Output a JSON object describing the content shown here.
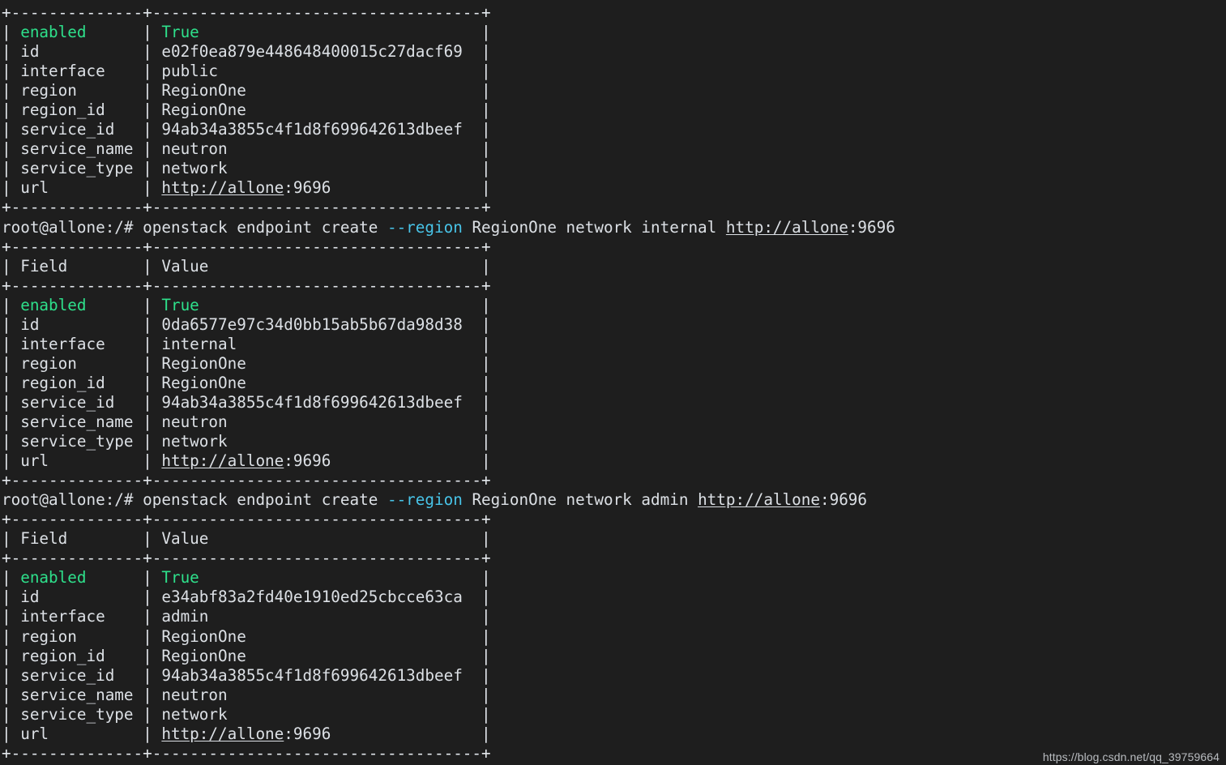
{
  "terminal": {
    "background_color": "#1e1e1e",
    "foreground_color": "#dce0e5",
    "accent_green": "#2ee08b",
    "accent_cyan": "#48c4e8",
    "prompt": "root@allone:/#",
    "rule_top": "+--------------+-----------------------------------+",
    "rule_mid": "+--------------+-----------------------------------+",
    "rule_bottom": "+--------------+-----------------------------------+"
  },
  "watermark": "https://blog.csdn.net/qq_39759664",
  "headers": {
    "field": "| Field        | Value                             |",
    "field_label": "Field",
    "value_label": "Value"
  },
  "blocks": [
    {
      "id": "block-public",
      "has_command": false,
      "command": {
        "prompt": "",
        "pre": "",
        "flag": "",
        "post": "",
        "url": "",
        "port": ""
      },
      "has_header": false,
      "rows": [
        {
          "field": "enabled",
          "value": "True",
          "field_color": "green",
          "value_color": "green",
          "link": false
        },
        {
          "field": "id",
          "value": "e02f0ea879e448648400015c27dacf69",
          "field_color": "default",
          "value_color": "default",
          "link": false
        },
        {
          "field": "interface",
          "value": "public",
          "field_color": "default",
          "value_color": "default",
          "link": false
        },
        {
          "field": "region",
          "value": "RegionOne",
          "field_color": "default",
          "value_color": "default",
          "link": false
        },
        {
          "field": "region_id",
          "value": "RegionOne",
          "field_color": "default",
          "value_color": "default",
          "link": false
        },
        {
          "field": "service_id",
          "value": "94ab34a3855c4f1d8f699642613dbeef",
          "field_color": "default",
          "value_color": "default",
          "link": false
        },
        {
          "field": "service_name",
          "value": "neutron",
          "field_color": "default",
          "value_color": "default",
          "link": false
        },
        {
          "field": "service_type",
          "value": "network",
          "field_color": "default",
          "value_color": "default",
          "link": false
        },
        {
          "field": "url",
          "value": "http://allone:9696",
          "field_color": "default",
          "value_color": "default",
          "link": true,
          "link_text": "http://allone",
          "link_tail": ":9696"
        }
      ]
    },
    {
      "id": "block-internal",
      "has_command": true,
      "command": {
        "prompt": "root@allone:/#",
        "pre": " openstack endpoint create ",
        "flag": "--region",
        "post": " RegionOne network internal ",
        "url": "http://allone",
        "port": ":9696"
      },
      "has_header": true,
      "rows": [
        {
          "field": "enabled",
          "value": "True",
          "field_color": "green",
          "value_color": "green",
          "link": false
        },
        {
          "field": "id",
          "value": "0da6577e97c34d0bb15ab5b67da98d38",
          "field_color": "default",
          "value_color": "default",
          "link": false
        },
        {
          "field": "interface",
          "value": "internal",
          "field_color": "default",
          "value_color": "default",
          "link": false
        },
        {
          "field": "region",
          "value": "RegionOne",
          "field_color": "default",
          "value_color": "default",
          "link": false
        },
        {
          "field": "region_id",
          "value": "RegionOne",
          "field_color": "default",
          "value_color": "default",
          "link": false
        },
        {
          "field": "service_id",
          "value": "94ab34a3855c4f1d8f699642613dbeef",
          "field_color": "default",
          "value_color": "default",
          "link": false
        },
        {
          "field": "service_name",
          "value": "neutron",
          "field_color": "default",
          "value_color": "default",
          "link": false
        },
        {
          "field": "service_type",
          "value": "network",
          "field_color": "default",
          "value_color": "default",
          "link": false
        },
        {
          "field": "url",
          "value": "http://allone:9696",
          "field_color": "default",
          "value_color": "default",
          "link": true,
          "link_text": "http://allone",
          "link_tail": ":9696"
        }
      ]
    },
    {
      "id": "block-admin",
      "has_command": true,
      "command": {
        "prompt": "root@allone:/#",
        "pre": " openstack endpoint create ",
        "flag": "--region",
        "post": " RegionOne network admin ",
        "url": "http://allone",
        "port": ":9696"
      },
      "has_header": true,
      "rows": [
        {
          "field": "enabled",
          "value": "True",
          "field_color": "green",
          "value_color": "green",
          "link": false
        },
        {
          "field": "id",
          "value": "e34abf83a2fd40e1910ed25cbcce63ca",
          "field_color": "default",
          "value_color": "default",
          "link": false
        },
        {
          "field": "interface",
          "value": "admin",
          "field_color": "default",
          "value_color": "default",
          "link": false
        },
        {
          "field": "region",
          "value": "RegionOne",
          "field_color": "default",
          "value_color": "default",
          "link": false
        },
        {
          "field": "region_id",
          "value": "RegionOne",
          "field_color": "default",
          "value_color": "default",
          "link": false
        },
        {
          "field": "service_id",
          "value": "94ab34a3855c4f1d8f699642613dbeef",
          "field_color": "default",
          "value_color": "default",
          "link": false
        },
        {
          "field": "service_name",
          "value": "neutron",
          "field_color": "default",
          "value_color": "default",
          "link": false
        },
        {
          "field": "service_type",
          "value": "network",
          "field_color": "default",
          "value_color": "default",
          "link": false
        },
        {
          "field": "url",
          "value": "http://allone:9696",
          "field_color": "default",
          "value_color": "default",
          "link": true,
          "link_text": "http://allone",
          "link_tail": ":9696"
        }
      ]
    }
  ]
}
